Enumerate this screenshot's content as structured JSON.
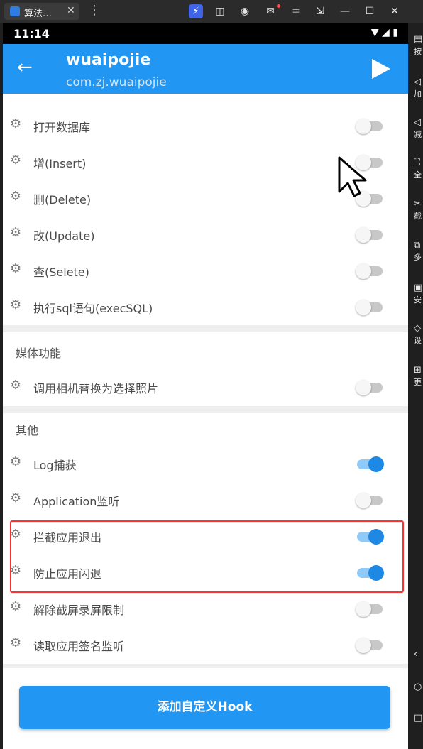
{
  "window": {
    "tab_title": "算法…",
    "tab_close": "✕",
    "menu_icon": "kebab-icon",
    "toolbar_icons": [
      "bolt-icon",
      "gamepad-icon",
      "account-icon",
      "mail-icon",
      "menu-icon",
      "screen-icon",
      "minimize-icon",
      "maximize-icon",
      "close-icon"
    ]
  },
  "status_bar": {
    "time": "11:14"
  },
  "app_bar": {
    "title": "wuaipojie",
    "subtitle": "com.zj.wuaipojie"
  },
  "sections": {
    "database_items": [
      {
        "label": "打开数据库",
        "enabled": false
      },
      {
        "label": "增(Insert)",
        "enabled": false
      },
      {
        "label": "删(Delete)",
        "enabled": false
      },
      {
        "label": "改(Update)",
        "enabled": false
      },
      {
        "label": "查(Selete)",
        "enabled": false
      },
      {
        "label": "执行sql语句(execSQL)",
        "enabled": false
      }
    ],
    "media_title": "媒体功能",
    "media_items": [
      {
        "label": "调用相机替换为选择照片",
        "enabled": false
      }
    ],
    "other_title": "其他",
    "other_items": [
      {
        "label": "Log捕获",
        "enabled": true
      },
      {
        "label": "Application监听",
        "enabled": false
      },
      {
        "label": "拦截应用退出",
        "enabled": true
      },
      {
        "label": "防止应用闪退",
        "enabled": true
      },
      {
        "label": "解除截屏录屏限制",
        "enabled": false
      },
      {
        "label": "读取应用签名监听",
        "enabled": false
      }
    ]
  },
  "add_hook_button": "添加自定义Hook",
  "sidebar_labels": [
    "按",
    "加",
    "减",
    "全",
    "截",
    "多",
    "安",
    "设",
    "更"
  ],
  "colors": {
    "primary": "#2196f3",
    "switch_on": "#1e88e5",
    "highlight": "#ff3030"
  }
}
